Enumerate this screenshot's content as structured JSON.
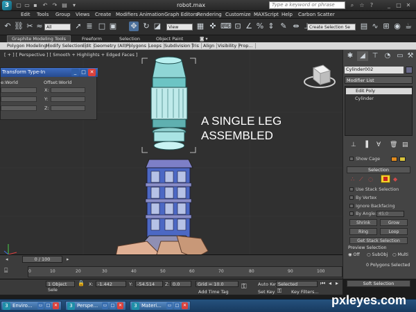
{
  "app": {
    "logo": "3",
    "title": "robot.max",
    "search_placeholder": "Type a keyword or phrase"
  },
  "menu": [
    "Edit",
    "Tools",
    "Group",
    "Views",
    "Create",
    "Modifiers",
    "Animation",
    "Graph Editors",
    "Rendering",
    "Customize",
    "MAXScript",
    "Help",
    "Carbon Scatter"
  ],
  "toolbar": {
    "selection_filter": "All",
    "ref_coord": "View",
    "named_selection": "Create Selection Se"
  },
  "ribbon": {
    "tabs": [
      "Graphite Modeling Tools",
      "Freeform",
      "Selection",
      "Object Paint"
    ],
    "panels": [
      "Polygon Modeling",
      "Modify Selection",
      "Edit",
      "Geometry (All)",
      "Polygons",
      "Loops",
      "Subdivision",
      "Tris",
      "Align",
      "Visibility",
      "Prop..."
    ]
  },
  "viewport": {
    "label": "[ + ] [ Perspective ] [ Smooth + Highlights + Edged Faces ]",
    "annotation_line1": "A SINGLE LEG",
    "annotation_line2": "ASSEMBLED"
  },
  "transform_typein": {
    "title": "Transform Type-In",
    "abs_label": "e:World",
    "offset_label": "Offset:World",
    "x_label": "X:",
    "y_label": "Y:",
    "z_label": "Z:"
  },
  "command_panel": {
    "object_name": "Cylinder002",
    "modifier_list": "Modifier List",
    "stack": [
      "Edit Poly",
      "Cylinder"
    ],
    "show_cage": "Show Cage",
    "selection_header": "Selection",
    "use_stack_selection": "Use Stack Selection",
    "by_vertex": "By Vertex",
    "ignore_backfacing": "Ignore Backfacing",
    "by_angle": "By Angle:",
    "by_angle_value": "45.0",
    "shrink": "Shrink",
    "grow": "Grow",
    "ring": "Ring",
    "loop": "Loop",
    "get_stack_selection": "Get Stack Selection",
    "preview_selection": "Preview Selection",
    "preview_off": "Off",
    "preview_subobj": "SubObj",
    "preview_multi": "Multi",
    "selected_count": "0 Polygons Selected",
    "soft_selection": "Soft Selection"
  },
  "timeline": {
    "frame": "0 / 100",
    "ticks": [
      "0",
      "10",
      "20",
      "30",
      "40",
      "50",
      "60",
      "70",
      "80",
      "90",
      "100"
    ]
  },
  "status": {
    "object_selected": "1 Object Sele",
    "x_label": "X:",
    "x_value": "-1.442",
    "y_label": "Y:",
    "y_value": "-54.514",
    "z_label": "Z:",
    "z_value": "0.0",
    "grid": "Grid = 10.0",
    "add_time_tag": "Add Time Tag",
    "auto_key": "Auto Key",
    "selected": "Selected",
    "set_key": "Set Key",
    "key_filters": "Key Filters..."
  },
  "taskbar": [
    "Enviro...",
    "Perspe...",
    "Materi..."
  ],
  "watermark": "pxleyes.com",
  "colors": {
    "accent_blue": "#2f6fc0",
    "viewport_bg": "#303030",
    "text_white": "#ffffff"
  }
}
